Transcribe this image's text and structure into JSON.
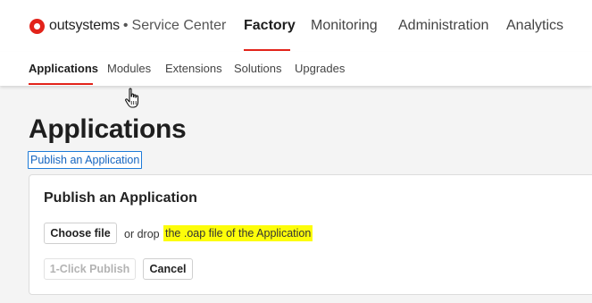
{
  "header": {
    "logo": {
      "brand": "outsystems",
      "separator": "•",
      "product": "Service Center",
      "color": "#e2231a"
    },
    "nav": [
      {
        "label": "Factory",
        "active": true
      },
      {
        "label": "Monitoring",
        "active": false
      },
      {
        "label": "Administration",
        "active": false
      },
      {
        "label": "Analytics",
        "active": false
      }
    ]
  },
  "subnav": [
    {
      "label": "Applications",
      "active": true
    },
    {
      "label": "Modules",
      "active": false
    },
    {
      "label": "Extensions",
      "active": false
    },
    {
      "label": "Solutions",
      "active": false
    },
    {
      "label": "Upgrades",
      "active": false
    }
  ],
  "page": {
    "title": "Applications",
    "publish_link": "Publish an Application"
  },
  "publish_card": {
    "title": "Publish an Application",
    "choose_file_label": "Choose file",
    "drop_prefix": "or drop",
    "drop_hint": "the .oap file of the Application",
    "one_click_label": "1-Click Publish",
    "one_click_enabled": false,
    "cancel_label": "Cancel"
  },
  "colors": {
    "accent": "#e2231a",
    "link": "#1565c0",
    "highlight": "#fdfd0a"
  },
  "cursor": {
    "icon": "hand-pointer-icon"
  }
}
